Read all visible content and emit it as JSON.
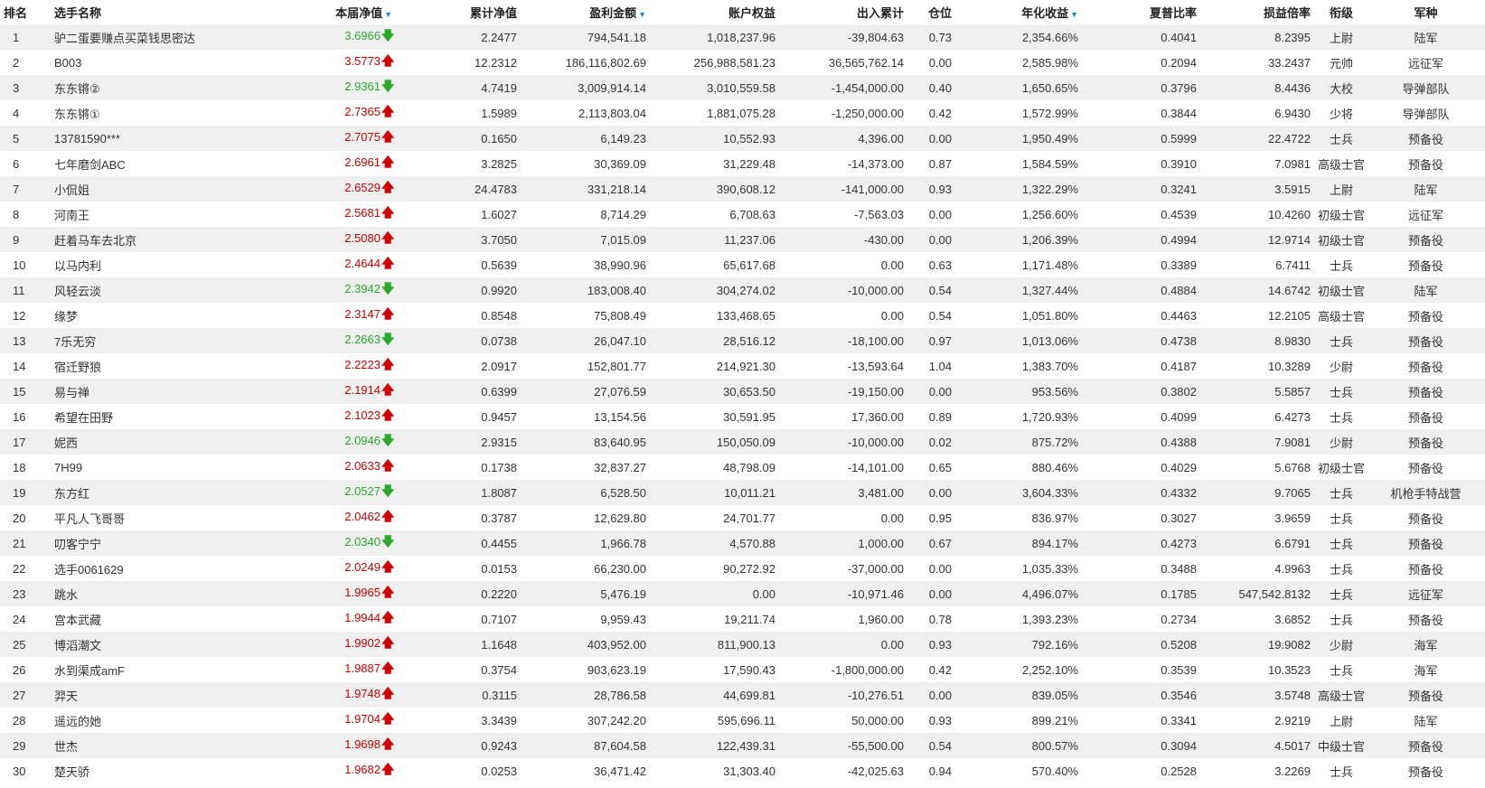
{
  "headers": {
    "rank": "排名",
    "name": "选手名称",
    "nav": "本届净值",
    "cum_nav": "累计净值",
    "profit": "盈利金额",
    "equity": "账户权益",
    "inout": "出入累计",
    "position": "仓位",
    "annual": "年化收益",
    "sharpe": "夏普比率",
    "pl_ratio": "损益倍率",
    "title": "衔级",
    "army": "军种"
  },
  "sort_indicator": "▼",
  "colors": {
    "up": "#d00000",
    "down": "#2aa82a",
    "sort": "#1a8fd0",
    "stripe": "#f0f0f0"
  },
  "rows": [
    {
      "rank": "1",
      "name": "驴二蛋要赚点买菜钱思密达",
      "nav": "3.6966",
      "dir": "down",
      "arrow": "🡇",
      "cum": "2.2477",
      "profit": "794,541.18",
      "equity": "1,018,237.96",
      "inout": "-39,804.63",
      "pos": "0.73",
      "annual": "2,354.66%",
      "sharpe": "0.4041",
      "pl": "8.2395",
      "title": "上尉",
      "army": "陆军"
    },
    {
      "rank": "2",
      "name": "B003",
      "nav": "3.5773",
      "dir": "up",
      "arrow": "🡅",
      "cum": "12.2312",
      "profit": "186,116,802.69",
      "equity": "256,988,581.23",
      "inout": "36,565,762.14",
      "pos": "0.00",
      "annual": "2,585.98%",
      "sharpe": "0.2094",
      "pl": "33.2437",
      "title": "元帅",
      "army": "远征军"
    },
    {
      "rank": "3",
      "name": "东东锵②",
      "nav": "2.9361",
      "dir": "down",
      "arrow": "🡇",
      "cum": "4.7419",
      "profit": "3,009,914.14",
      "equity": "3,010,559.58",
      "inout": "-1,454,000.00",
      "pos": "0.40",
      "annual": "1,650.65%",
      "sharpe": "0.3796",
      "pl": "8.4436",
      "title": "大校",
      "army": "导弹部队"
    },
    {
      "rank": "4",
      "name": "东东锵①",
      "nav": "2.7365",
      "dir": "up",
      "arrow": "🡅",
      "cum": "1.5989",
      "profit": "2,113,803.04",
      "equity": "1,881,075.28",
      "inout": "-1,250,000.00",
      "pos": "0.42",
      "annual": "1,572.99%",
      "sharpe": "0.3844",
      "pl": "6.9430",
      "title": "少将",
      "army": "导弹部队"
    },
    {
      "rank": "5",
      "name": "13781590***",
      "nav": "2.7075",
      "dir": "up",
      "arrow": "🡅",
      "cum": "0.1650",
      "profit": "6,149.23",
      "equity": "10,552.93",
      "inout": "4,396.00",
      "pos": "0.00",
      "annual": "1,950.49%",
      "sharpe": "0.5999",
      "pl": "22.4722",
      "title": "士兵",
      "army": "预备役"
    },
    {
      "rank": "6",
      "name": "七年磨剑ABC",
      "nav": "2.6961",
      "dir": "up",
      "arrow": "🡅",
      "cum": "3.2825",
      "profit": "30,369.09",
      "equity": "31,229.48",
      "inout": "-14,373.00",
      "pos": "0.87",
      "annual": "1,584.59%",
      "sharpe": "0.3910",
      "pl": "7.0981",
      "title": "高级士官",
      "army": "预备役"
    },
    {
      "rank": "7",
      "name": "小侃姐",
      "nav": "2.6529",
      "dir": "up",
      "arrow": "🡅",
      "cum": "24.4783",
      "profit": "331,218.14",
      "equity": "390,608.12",
      "inout": "-141,000.00",
      "pos": "0.93",
      "annual": "1,322.29%",
      "sharpe": "0.3241",
      "pl": "3.5915",
      "title": "上尉",
      "army": "陆军"
    },
    {
      "rank": "8",
      "name": "河南王",
      "nav": "2.5681",
      "dir": "up",
      "arrow": "🡅",
      "cum": "1.6027",
      "profit": "8,714.29",
      "equity": "6,708.63",
      "inout": "-7,563.03",
      "pos": "0.00",
      "annual": "1,256.60%",
      "sharpe": "0.4539",
      "pl": "10.4260",
      "title": "初级士官",
      "army": "远征军"
    },
    {
      "rank": "9",
      "name": "赶着马车去北京",
      "nav": "2.5080",
      "dir": "up",
      "arrow": "🡅",
      "cum": "3.7050",
      "profit": "7,015.09",
      "equity": "11,237.06",
      "inout": "-430.00",
      "pos": "0.00",
      "annual": "1,206.39%",
      "sharpe": "0.4994",
      "pl": "12.9714",
      "title": "初级士官",
      "army": "预备役"
    },
    {
      "rank": "10",
      "name": "以马内利",
      "nav": "2.4644",
      "dir": "up",
      "arrow": "🡅",
      "cum": "0.5639",
      "profit": "38,990.96",
      "equity": "65,617.68",
      "inout": "0.00",
      "pos": "0.63",
      "annual": "1,171.48%",
      "sharpe": "0.3389",
      "pl": "6.7411",
      "title": "士兵",
      "army": "预备役"
    },
    {
      "rank": "11",
      "name": "风轻云淡",
      "nav": "2.3942",
      "dir": "down",
      "arrow": "🡇",
      "cum": "0.9920",
      "profit": "183,008.40",
      "equity": "304,274.02",
      "inout": "-10,000.00",
      "pos": "0.54",
      "annual": "1,327.44%",
      "sharpe": "0.4884",
      "pl": "14.6742",
      "title": "初级士官",
      "army": "陆军"
    },
    {
      "rank": "12",
      "name": "缘梦",
      "nav": "2.3147",
      "dir": "up",
      "arrow": "🡅",
      "cum": "0.8548",
      "profit": "75,808.49",
      "equity": "133,468.65",
      "inout": "0.00",
      "pos": "0.54",
      "annual": "1,051.80%",
      "sharpe": "0.4463",
      "pl": "12.2105",
      "title": "高级士官",
      "army": "预备役"
    },
    {
      "rank": "13",
      "name": "7乐无穷",
      "nav": "2.2663",
      "dir": "down",
      "arrow": "🡇",
      "cum": "0.0738",
      "profit": "26,047.10",
      "equity": "28,516.12",
      "inout": "-18,100.00",
      "pos": "0.97",
      "annual": "1,013.06%",
      "sharpe": "0.4738",
      "pl": "8.9830",
      "title": "士兵",
      "army": "预备役"
    },
    {
      "rank": "14",
      "name": "宿迁野狼",
      "nav": "2.2223",
      "dir": "up",
      "arrow": "🡅",
      "cum": "2.0917",
      "profit": "152,801.77",
      "equity": "214,921.30",
      "inout": "-13,593.64",
      "pos": "1.04",
      "annual": "1,383.70%",
      "sharpe": "0.4187",
      "pl": "10.3289",
      "title": "少尉",
      "army": "预备役"
    },
    {
      "rank": "15",
      "name": "易与禅",
      "nav": "2.1914",
      "dir": "up",
      "arrow": "🡅",
      "cum": "0.6399",
      "profit": "27,076.59",
      "equity": "30,653.50",
      "inout": "-19,150.00",
      "pos": "0.00",
      "annual": "953.56%",
      "sharpe": "0.3802",
      "pl": "5.5857",
      "title": "士兵",
      "army": "预备役"
    },
    {
      "rank": "16",
      "name": "希望在田野",
      "nav": "2.1023",
      "dir": "up",
      "arrow": "🡅",
      "cum": "0.9457",
      "profit": "13,154.56",
      "equity": "30,591.95",
      "inout": "17,360.00",
      "pos": "0.89",
      "annual": "1,720.93%",
      "sharpe": "0.4099",
      "pl": "6.4273",
      "title": "士兵",
      "army": "预备役"
    },
    {
      "rank": "17",
      "name": "妮西",
      "nav": "2.0946",
      "dir": "down",
      "arrow": "🡇",
      "cum": "2.9315",
      "profit": "83,640.95",
      "equity": "150,050.09",
      "inout": "-10,000.00",
      "pos": "0.02",
      "annual": "875.72%",
      "sharpe": "0.4388",
      "pl": "7.9081",
      "title": "少尉",
      "army": "预备役"
    },
    {
      "rank": "18",
      "name": "7H99",
      "nav": "2.0633",
      "dir": "up",
      "arrow": "🡅",
      "cum": "0.1738",
      "profit": "32,837.27",
      "equity": "48,798.09",
      "inout": "-14,101.00",
      "pos": "0.65",
      "annual": "880.46%",
      "sharpe": "0.4029",
      "pl": "5.6768",
      "title": "初级士官",
      "army": "预备役"
    },
    {
      "rank": "19",
      "name": "东方红",
      "nav": "2.0527",
      "dir": "down",
      "arrow": "🡇",
      "cum": "1.8087",
      "profit": "6,528.50",
      "equity": "10,011.21",
      "inout": "3,481.00",
      "pos": "0.00",
      "annual": "3,604.33%",
      "sharpe": "0.4332",
      "pl": "9.7065",
      "title": "士兵",
      "army": "机枪手特战营"
    },
    {
      "rank": "20",
      "name": "平凡人飞哥哥",
      "nav": "2.0462",
      "dir": "up",
      "arrow": "🡅",
      "cum": "0.3787",
      "profit": "12,629.80",
      "equity": "24,701.77",
      "inout": "0.00",
      "pos": "0.95",
      "annual": "836.97%",
      "sharpe": "0.3027",
      "pl": "3.9659",
      "title": "士兵",
      "army": "预备役"
    },
    {
      "rank": "21",
      "name": "叨客宁宁",
      "nav": "2.0340",
      "dir": "down",
      "arrow": "🡇",
      "cum": "0.4455",
      "profit": "1,966.78",
      "equity": "4,570.88",
      "inout": "1,000.00",
      "pos": "0.67",
      "annual": "894.17%",
      "sharpe": "0.4273",
      "pl": "6.6791",
      "title": "士兵",
      "army": "预备役"
    },
    {
      "rank": "22",
      "name": "选手0061629",
      "nav": "2.0249",
      "dir": "up",
      "arrow": "🡅",
      "cum": "0.0153",
      "profit": "66,230.00",
      "equity": "90,272.92",
      "inout": "-37,000.00",
      "pos": "0.00",
      "annual": "1,035.33%",
      "sharpe": "0.3488",
      "pl": "4.9963",
      "title": "士兵",
      "army": "预备役"
    },
    {
      "rank": "23",
      "name": "跳水",
      "nav": "1.9965",
      "dir": "up",
      "arrow": "🡅",
      "cum": "0.2220",
      "profit": "5,476.19",
      "equity": "0.00",
      "inout": "-10,971.46",
      "pos": "0.00",
      "annual": "4,496.07%",
      "sharpe": "0.1785",
      "pl": "547,542.8132",
      "title": "士兵",
      "army": "远征军"
    },
    {
      "rank": "24",
      "name": "宫本武藏",
      "nav": "1.9944",
      "dir": "up",
      "arrow": "🡅",
      "cum": "0.7107",
      "profit": "9,959.43",
      "equity": "19,211.74",
      "inout": "1,960.00",
      "pos": "0.78",
      "annual": "1,393.23%",
      "sharpe": "0.2734",
      "pl": "3.6852",
      "title": "士兵",
      "army": "预备役"
    },
    {
      "rank": "25",
      "name": "博滔潮文",
      "nav": "1.9902",
      "dir": "up",
      "arrow": "🡅",
      "cum": "1.1648",
      "profit": "403,952.00",
      "equity": "811,900.13",
      "inout": "0.00",
      "pos": "0.93",
      "annual": "792.16%",
      "sharpe": "0.5208",
      "pl": "19.9082",
      "title": "少尉",
      "army": "海军"
    },
    {
      "rank": "26",
      "name": "水到渠成amF",
      "nav": "1.9887",
      "dir": "up",
      "arrow": "🡅",
      "cum": "0.3754",
      "profit": "903,623.19",
      "equity": "17,590.43",
      "inout": "-1,800,000.00",
      "pos": "0.42",
      "annual": "2,252.10%",
      "sharpe": "0.3539",
      "pl": "10.3523",
      "title": "士兵",
      "army": "海军"
    },
    {
      "rank": "27",
      "name": "羿天",
      "nav": "1.9748",
      "dir": "up",
      "arrow": "🡅",
      "cum": "0.3115",
      "profit": "28,786.58",
      "equity": "44,699.81",
      "inout": "-10,276.51",
      "pos": "0.00",
      "annual": "839.05%",
      "sharpe": "0.3546",
      "pl": "3.5748",
      "title": "高级士官",
      "army": "预备役"
    },
    {
      "rank": "28",
      "name": "遥远的她",
      "nav": "1.9704",
      "dir": "up",
      "arrow": "🡅",
      "cum": "3.3439",
      "profit": "307,242.20",
      "equity": "595,696.11",
      "inout": "50,000.00",
      "pos": "0.93",
      "annual": "899.21%",
      "sharpe": "0.3341",
      "pl": "2.9219",
      "title": "上尉",
      "army": "陆军"
    },
    {
      "rank": "29",
      "name": "世杰",
      "nav": "1.9698",
      "dir": "up",
      "arrow": "🡅",
      "cum": "0.9243",
      "profit": "87,604.58",
      "equity": "122,439.31",
      "inout": "-55,500.00",
      "pos": "0.54",
      "annual": "800.57%",
      "sharpe": "0.3094",
      "pl": "4.5017",
      "title": "中级士官",
      "army": "预备役"
    },
    {
      "rank": "30",
      "name": "楚天骄",
      "nav": "1.9682",
      "dir": "up",
      "arrow": "🡅",
      "cum": "0.0253",
      "profit": "36,471.42",
      "equity": "31,303.40",
      "inout": "-42,025.63",
      "pos": "0.94",
      "annual": "570.40%",
      "sharpe": "0.2528",
      "pl": "3.2269",
      "title": "士兵",
      "army": "预备役"
    }
  ]
}
